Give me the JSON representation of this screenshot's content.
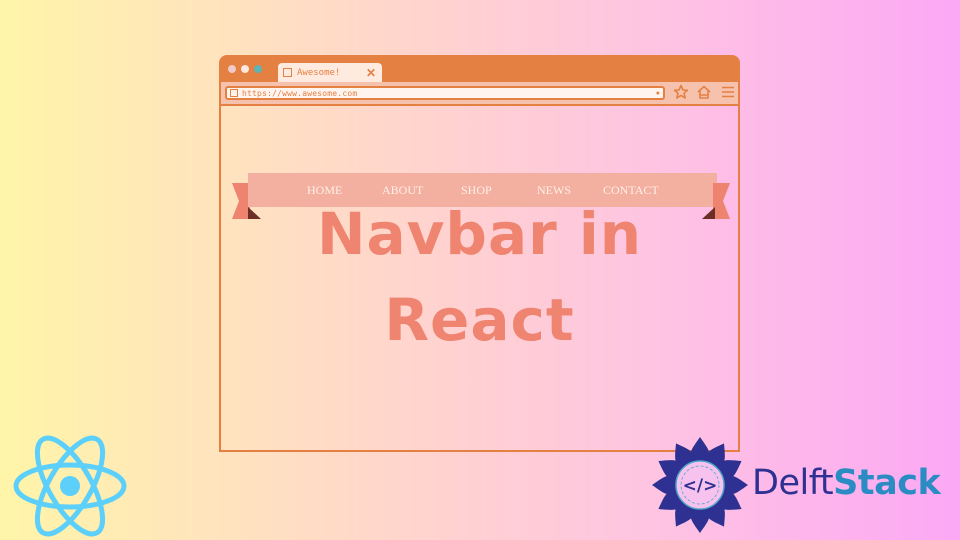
{
  "browser": {
    "tab_title": "Awesome!",
    "tab_close_icon": "close-icon",
    "url": "https://www.awesome.com",
    "toolbar_icons": [
      "star-icon",
      "home-icon",
      "menu-icon"
    ]
  },
  "navbar": {
    "items": [
      {
        "label": "HOME"
      },
      {
        "label": "ABOUT"
      },
      {
        "label": "SHOP"
      },
      {
        "label": "NEWS"
      },
      {
        "label": "CONTACT"
      }
    ]
  },
  "headline": {
    "line1": "Navbar in",
    "line2": "React"
  },
  "branding": {
    "delft_part1": "Delft",
    "delft_part2": "Stack",
    "emblem_code": "</>"
  },
  "colors": {
    "frame": "#e58043",
    "headline": "#ef8470",
    "navbar_bg": "#f3afa0",
    "react_blue": "#5cd0fa",
    "delft_dark": "#2e3192",
    "delft_light": "#2b8cc4"
  }
}
